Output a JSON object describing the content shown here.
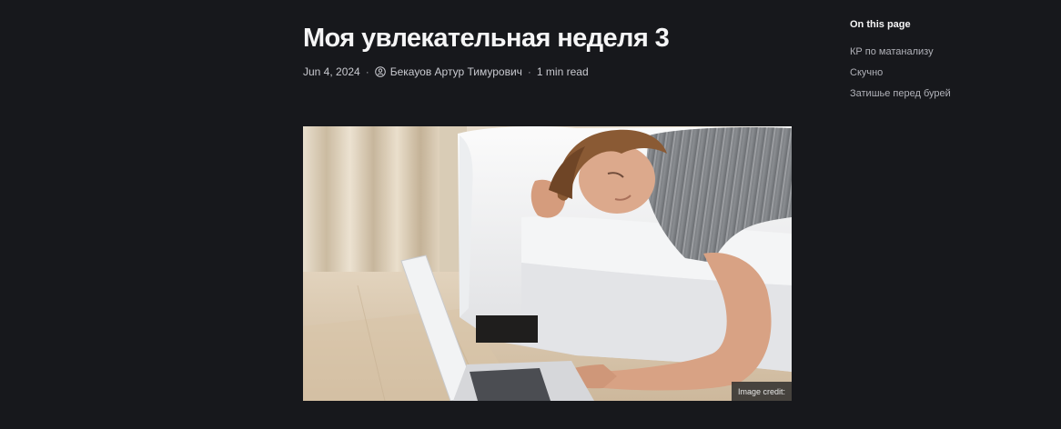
{
  "article": {
    "title": "Моя увлекательная неделя 3",
    "date": "Jun 4, 2024",
    "separator": "·",
    "author": "Бекауов Артур Тимурович",
    "read_time": "1 min read",
    "author_icon": "author-icon"
  },
  "hero": {
    "credit": "Image credit:"
  },
  "toc": {
    "title": "On this page",
    "items": [
      {
        "label": "КР по матанализу"
      },
      {
        "label": "Скучно"
      },
      {
        "label": "Затишье перед бурей"
      }
    ]
  },
  "colors": {
    "background": "#17181c",
    "text_primary": "#f5f5f6",
    "text_secondary": "#b0b1b8"
  }
}
